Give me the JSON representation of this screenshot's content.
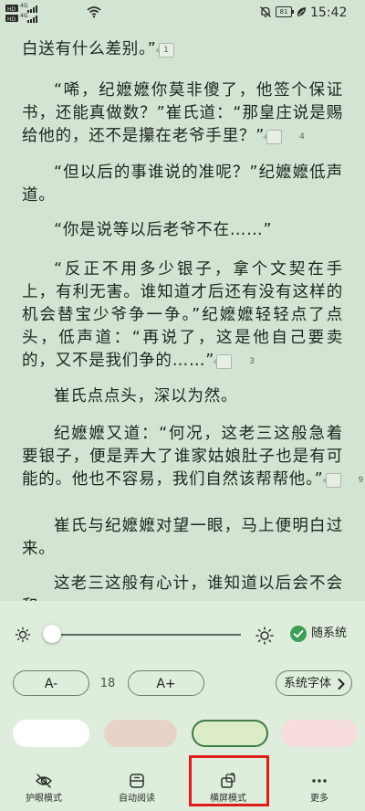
{
  "status_bar": {
    "hd_label": "HD",
    "net_labels": [
      "4G",
      "4G"
    ],
    "battery": "81",
    "time": "15:42"
  },
  "reader": {
    "paragraphs": [
      {
        "text": "白送有什么差别。”",
        "note": "1"
      },
      {
        "text": "“唏，纪嬷嬷你莫非傻了，他签个保证书，还能真做数？”崔氏道：“那皇庄说是赐给他的，还不是攥在老爷手里？”",
        "note": "4"
      },
      {
        "text": "“但以后的事谁说的准呢？”纪嬷嬷低声道。",
        "note": ""
      },
      {
        "text": "“你是说等以后老爷不在……”",
        "note": ""
      },
      {
        "text": "“反正不用多少银子，拿个文契在手上，有利无害。谁知道才后还有没有这样的机会替宝少爷争一争。”纪嬷嬷轻轻点了点头，低声道：“再说了，这是他自己要卖的，又不是我们争的……”",
        "note": "3"
      },
      {
        "text": "崔氏点点头，深以为然。",
        "note": ""
      },
      {
        "text": "纪嬷嬷又道：“何况，这老三这般急着要银子，便是弄大了谁家姑娘肚子也是有可能的。他也不容易，我们自然该帮帮他。”",
        "note": "9"
      },
      {
        "text": "崔氏与纪嬷嬷对望一眼，马上便明白过来。",
        "note": ""
      },
      {
        "text": "这老三这般有心计，谁知道以后会不会和",
        "note": ""
      }
    ]
  },
  "settings": {
    "brightness": {
      "level": 0.02,
      "follow_system_label": "随系统",
      "follow_system_checked": true
    },
    "font": {
      "decrease_label": "A-",
      "size_value": "18",
      "increase_label": "A+",
      "font_button_label": "系统字体"
    },
    "themes": [
      {
        "name": "white",
        "color": "#ffffff",
        "selected": false
      },
      {
        "name": "pink-beige",
        "color": "#e8d3c9",
        "selected": false
      },
      {
        "name": "light-green",
        "color": "#dcebc8",
        "selected": true
      },
      {
        "name": "light-pink",
        "color": "#f6dcdc",
        "selected": false
      }
    ],
    "nav": [
      {
        "label": "护眼模式",
        "icon": "eye-off-icon"
      },
      {
        "label": "自动阅读",
        "icon": "auto-read-icon"
      },
      {
        "label": "横屏模式",
        "icon": "rotate-screen-icon"
      },
      {
        "label": "更多",
        "icon": "more-dots-icon"
      }
    ]
  },
  "colors": {
    "page_background": "#d3e5d2",
    "panel_background": "#dfeedc",
    "accent_green": "#3e9d57",
    "highlight_red": "#e11a1a"
  }
}
